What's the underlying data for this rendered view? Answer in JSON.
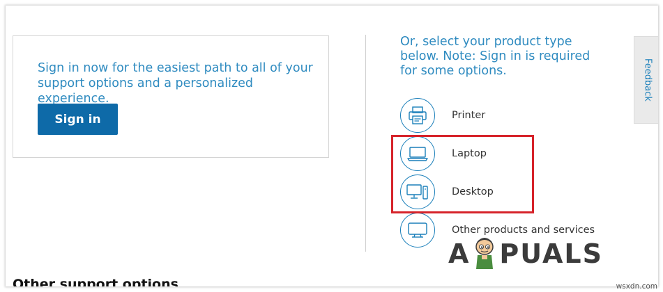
{
  "signin": {
    "text": "Sign in now for the easiest path to all of your support options and a personalized experience.",
    "button_label": "Sign in"
  },
  "product_select": {
    "heading": "Or, select your product type below. Note: Sign in is required for some options.",
    "items": [
      {
        "label": "Printer",
        "icon": "printer-icon"
      },
      {
        "label": "Laptop",
        "icon": "laptop-icon"
      },
      {
        "label": "Desktop",
        "icon": "desktop-icon"
      },
      {
        "label": "Other products and services",
        "icon": "monitor-icon"
      }
    ]
  },
  "feedback": {
    "label": "Feedback"
  },
  "other_support": {
    "heading": "Other support options"
  },
  "branding": {
    "logo_left": "A",
    "logo_right": "PUALS",
    "watermark": "wsxdn.com"
  },
  "colors": {
    "accent_text": "#2f8bc0",
    "button": "#0e6aa8",
    "icon_stroke": "#1a7fba",
    "highlight": "#d6232a"
  }
}
